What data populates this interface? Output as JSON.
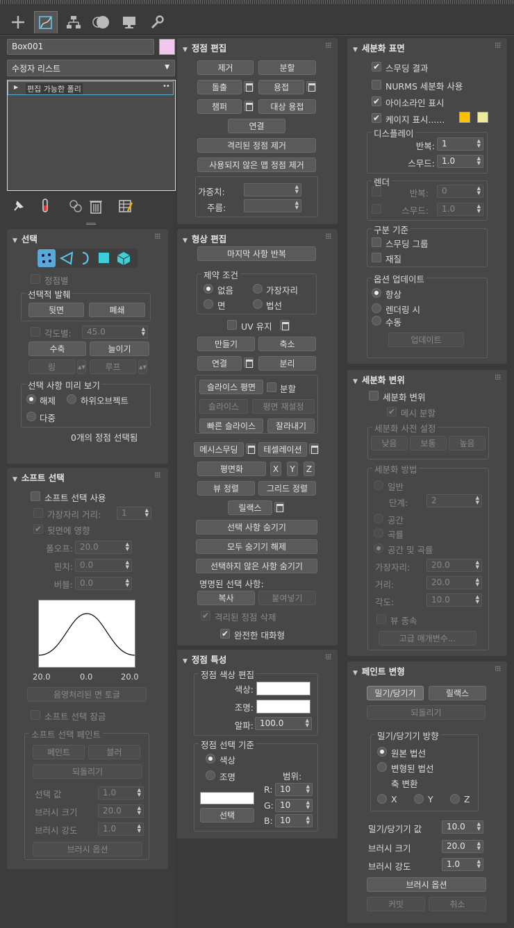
{
  "tabs": [
    "create-icon",
    "modify-icon",
    "hierarchy-icon",
    "motion-icon",
    "display-icon",
    "utilities-icon"
  ],
  "object": {
    "name": "Box001",
    "color": "#f3c6ee",
    "modifier_list": "수정자 리스트",
    "stack_item": "편집 가능한 폴리"
  },
  "selection": {
    "title": "선택",
    "by_vertex": "정점별",
    "ignore_backfacing_group": "선택적 발췌",
    "backface": "뒷면",
    "occluded": "폐쇄",
    "by_angle": "각도별:",
    "angle": "45.0",
    "shrink": "수축",
    "grow": "늘이기",
    "ring": "링",
    "loop": "루프",
    "preview_group": "선택 사항 미리 보기",
    "preview_off": "해제",
    "preview_subobj": "하위오브젝트",
    "preview_multi": "다중",
    "status": "0개의 정점 선택됨"
  },
  "soft": {
    "title": "소프트 선택",
    "use": "소프트 선택 사용",
    "edge_dist": "가장자리 거리:",
    "edge_val": "1",
    "affect_back": "뒷면에 영향",
    "falloff": "폴오프:",
    "falloff_val": "20.0",
    "pinch": "핀치:",
    "pinch_val": "0.0",
    "bubble": "버블:",
    "bubble_val": "0.0",
    "axis_left": "20.0",
    "axis_mid": "0.0",
    "axis_right": "20.0",
    "shaded_toggle": "음영처리된 면 토글",
    "lock": "소프트 선택 잠금",
    "paint_group": "소프트 선택 페인트",
    "paint": "페인트",
    "blur": "블러",
    "revert": "되돌리기",
    "sel_value": "선택 값",
    "sel_value_v": "1.0",
    "brush_size": "브러시 크기",
    "brush_size_v": "20.0",
    "brush_strength": "브러시 강도",
    "brush_strength_v": "1.0",
    "brush_options": "브러시 옵션"
  },
  "edit_vertices": {
    "title": "정점 편집",
    "remove": "제거",
    "break": "분할",
    "extrude": "돌출",
    "weld": "용접",
    "chamfer": "챔퍼",
    "target_weld": "대상 용접",
    "connect": "연결",
    "remove_isolated": "격리된 정점 제거",
    "remove_unused": "사용되지 않은 맵 정점 제거",
    "weight": "가중치:",
    "crease": "주름:"
  },
  "edit_geometry": {
    "title": "형상 편집",
    "repeat_last": "마지막 사항 반복",
    "constraints_group": "제약 조건",
    "c_none": "없음",
    "c_edge": "가장자리",
    "c_face": "면",
    "c_normal": "법선",
    "preserve_uv": "UV 유지",
    "create": "만들기",
    "collapse": "축소",
    "attach": "연결",
    "detach": "분리",
    "slice_plane": "슬라이스 평면",
    "split": "분할",
    "slice": "슬라이스",
    "reset_plane": "평면 재설정",
    "quickslice": "빠른 슬라이스",
    "cut": "잘라내기",
    "meshsmooth": "메시스무딩",
    "tessellate": "테셀레이션",
    "make_planar": "평면화",
    "x": "X",
    "y": "Y",
    "z": "Z",
    "view_align": "뷰 정렬",
    "grid_align": "그리드 정렬",
    "relax": "릴랙스",
    "hide_selected": "선택 사항 숨기기",
    "unhide_all": "모두 숨기기 해제",
    "hide_unselected": "선택하지 않은 사항 숨기기",
    "named_sel": "명명된 선택 사항:",
    "copy": "복사",
    "paste": "붙여넣기",
    "delete_isolated": "격리된 정점 삭제",
    "full_interactivity": "완전한 대화형"
  },
  "vertex_props": {
    "title": "정점 특성",
    "edit_color_group": "정점 색상 편집",
    "color": "색상:",
    "illum": "조명:",
    "alpha": "알파:",
    "alpha_val": "100.0",
    "select_by_group": "정점 선택 기준",
    "by_color": "색상",
    "by_illum": "조명",
    "range": "범위:",
    "select": "선택",
    "r": "R:",
    "g": "G:",
    "b": "B:",
    "rv": "10",
    "gv": "10",
    "bv": "10"
  },
  "subdiv_surface": {
    "title": "세분화 표면",
    "smooth_result": "스무딩 결과",
    "use_nurms": "NURMS 세분화 사용",
    "isoline": "아이소라인 표시",
    "show_cage": "케이지 표시......",
    "cage_color1": "#ffc000",
    "cage_color2": "#ecec9a",
    "display_group": "디스플레이",
    "iterations": "반복:",
    "iter_val": "1",
    "smoothness": "스무드:",
    "smooth_val": "1.0",
    "render_group": "렌더",
    "r_iterations": "반복:",
    "r_iter_val": "0",
    "r_smoothness": "스무드:",
    "r_smooth_val": "1.0",
    "sep_group": "구분 기준",
    "smoothing_groups": "스무딩 그룹",
    "materials": "재질",
    "update_group": "옵션 업데이트",
    "always": "항상",
    "when_render": "렌더링 시",
    "manually": "수동",
    "update": "업데이트"
  },
  "subdiv_disp": {
    "title": "세분화 변위",
    "subdiv_disp": "세분화 변위",
    "split_mesh": "메시 분할",
    "presets_group": "세분화 사전 설정",
    "low": "낮음",
    "medium": "보통",
    "high": "높음",
    "method_group": "세분화 방법",
    "regular": "일반",
    "steps": "단계:",
    "steps_val": "2",
    "spatial": "공간",
    "curvature": "곡률",
    "spatial_curv": "공간 및 곡률",
    "edge": "가장자리:",
    "edge_val": "20.0",
    "distance": "거리:",
    "distance_val": "20.0",
    "angle": "각도:",
    "angle_val": "10.0",
    "view_dep": "뷰 종속",
    "advanced": "고급 매개변수..."
  },
  "paint_deform": {
    "title": "페인트 변형",
    "pushpull": "밀기/당기기",
    "relax": "릴랙스",
    "revert": "되돌리기",
    "dir_group": "밀기/당기기 방향",
    "orig_normals": "원본 법선",
    "deformed_normals": "변형된 법선",
    "transform_axis": "축 변환",
    "x": "X",
    "y": "Y",
    "z": "Z",
    "pp_value": "밀기/당기기 값",
    "pp_val": "10.0",
    "brush_size": "브러시 크기",
    "brush_size_v": "20.0",
    "brush_strength": "브러시 강도",
    "brush_strength_v": "1.0",
    "brush_options": "브러시 옵션",
    "commit": "커밋",
    "cancel": "취소"
  }
}
